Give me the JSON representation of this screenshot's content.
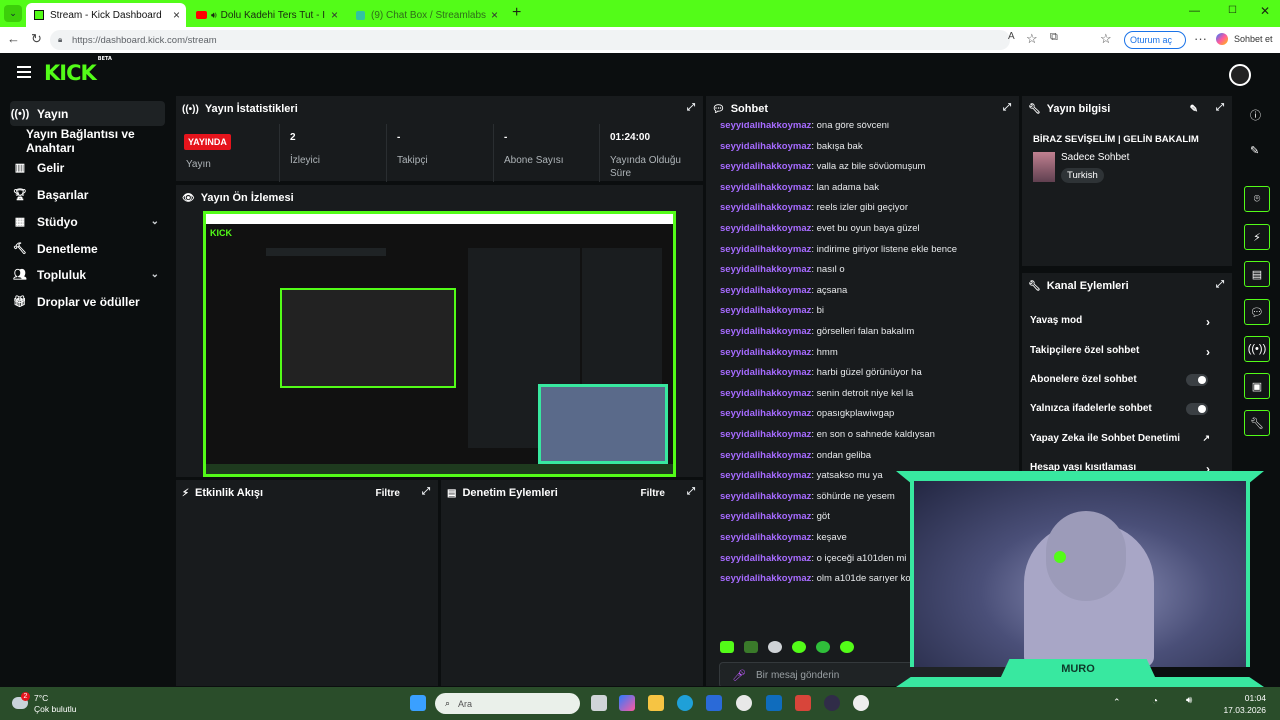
{
  "browser": {
    "tabs": [
      {
        "title": "Stream - Kick Dashboard"
      },
      {
        "title": "Dolu Kadehi Ters Tut - İslamist"
      },
      {
        "title": "(9) Chat Box / Streamlabs"
      }
    ],
    "url": "https://dashboard.kick.com/stream",
    "profile_label": "Oturum aç",
    "copilot_label": "Sohbet et"
  },
  "app": {
    "logo": "KICK",
    "logo_tag": "BETA",
    "sidebar": [
      {
        "label": "Yayın",
        "icon": "broadcast-icon"
      },
      {
        "label": "Yayın Bağlantısı ve Anahtarı",
        "icon": ""
      },
      {
        "label": "Gelir",
        "icon": "revenue-icon"
      },
      {
        "label": "Başarılar",
        "icon": "trophy-icon"
      },
      {
        "label": "Stüdyo",
        "icon": "studio-icon"
      },
      {
        "label": "Denetleme",
        "icon": "hammer-icon"
      },
      {
        "label": "Topluluk",
        "icon": "community-icon"
      },
      {
        "label": "Droplar ve ödüller",
        "icon": "gift-icon"
      }
    ],
    "stats": {
      "title": "Yayın İstatistikleri",
      "live_badge": "YAYINDA",
      "cells": [
        {
          "value": "",
          "label": "Yayın"
        },
        {
          "value": "2",
          "label": "İzleyici"
        },
        {
          "value": "-",
          "label": "Takipçi"
        },
        {
          "value": "-",
          "label": "Abone Sayısı"
        },
        {
          "value": "01:24:00",
          "label": "Yayında Olduğu Süre"
        }
      ]
    },
    "preview": {
      "title": "Yayın Ön İzlemesi"
    },
    "activity": {
      "title": "Etkinlik Akışı",
      "filter": "Filtre"
    },
    "modlog": {
      "title": "Denetim Eylemleri",
      "filter": "Filtre"
    },
    "chat": {
      "title": "Sohbet",
      "username": "seyyidalihakkoymaz",
      "messages": [
        "ona göre sövceni",
        "bakışa bak",
        "valla az bile sövüomuşum",
        "lan adama bak",
        "reels izler gibi geçiyor",
        "evet bu oyun baya güzel",
        "indirime giriyor listene ekle bence",
        "nasıl o",
        "açsana",
        "bi",
        "görselleri falan bakalım",
        "hmm",
        "harbi güzel görünüyor ha",
        "senin detroit niye kel la",
        "opasıgkplawiwgap",
        "en son o sahnede kaldıysan",
        "ondan geliba",
        "yatsakso mu ya",
        "söhürde ne yesem",
        "göt",
        "keşave",
        "o içeceği a101den mi",
        "olm a101de sarıyer ko"
      ],
      "input_placeholder": "Bir mesaj gönderin"
    },
    "stream_info": {
      "title": "Yayın bilgisi",
      "stream_title": "BİRAZ SEVİŞELİM | GELİN BAKALIM",
      "category": "Sadece Sohbet",
      "tag": "Turkish"
    },
    "channel_actions": {
      "title": "Kanal Eylemleri",
      "items": [
        {
          "label": "Yavaş mod",
          "control": "arrow"
        },
        {
          "label": "Takipçilere özel sohbet",
          "control": "arrow"
        },
        {
          "label": "Abonelere özel sohbet",
          "control": "toggle"
        },
        {
          "label": "Yalnızca ifadelerle sohbet",
          "control": "toggle"
        },
        {
          "label": "Yapay Zeka ile Sohbet Denetimi",
          "control": "external"
        },
        {
          "label": "Hesap yaşı kısıtlaması",
          "control": "arrow"
        }
      ]
    },
    "webcam_label": "MURO"
  },
  "taskbar": {
    "weather_temp": "7°C",
    "weather_text": "Çok bulutlu",
    "search_placeholder": "Ara",
    "time": "01:04",
    "date": "17.03.2026",
    "notif_count": "2"
  },
  "colors": {
    "accent": "#53fc18",
    "live": "#e6141c",
    "username": "#a66bff"
  }
}
